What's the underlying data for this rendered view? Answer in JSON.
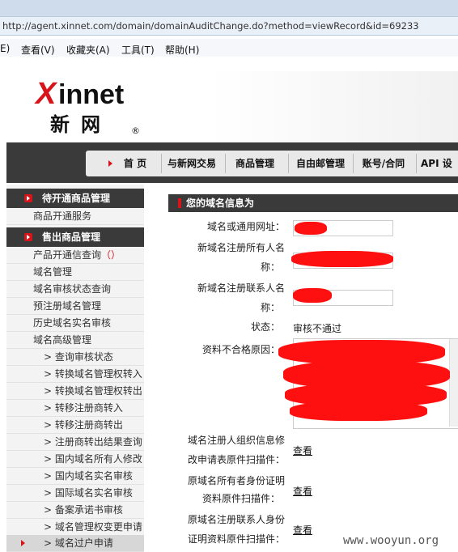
{
  "browser": {
    "url": "http://agent.xinnet.com/domain/domainAuditChange.do?method=viewRecord&id=69233",
    "menu": [
      "E)",
      "查看(V)",
      "收藏夹(A)",
      "工具(T)",
      "帮助(H)"
    ]
  },
  "logo": {
    "x": "X",
    "word": "innet",
    "cn": "新网",
    "reg": "®"
  },
  "nav": [
    "首 页",
    "与新网交易",
    "商品管理",
    "自由邮管理",
    "账号/合同",
    "API 设"
  ],
  "sidebar": {
    "section1": "待开通商品管理",
    "section1_items": [
      "商品开通服务"
    ],
    "section2": "售出商品管理",
    "section2_items": [
      "产品开通信查询",
      "域名管理",
      "域名审核状态查询",
      "预注册域名管理",
      "历史域名实名审核",
      "域名高级管理"
    ],
    "paren": "（）",
    "sub_items": [
      "> 查询审核状态",
      "> 转换域名管理权转入",
      "> 转换域名管理权转出",
      "> 转移注册商转入",
      "> 转移注册商转出",
      "> 注册商转出结果查询",
      "> 国内域名所有人修改",
      "> 国内域名实名审核",
      "> 国际域名实名审核",
      "> 备案承诺书审核",
      "> 域名管理权变更申请",
      "> 域名过户申请"
    ]
  },
  "main": {
    "title": "您的域名信息为",
    "fields": {
      "domain_label": "域名或通用网址：",
      "owner_label_1": "新域名注册所有人名",
      "owner_label_2": "称：",
      "contact_label_1": "新域名注册联系人名",
      "contact_label_2": "称：",
      "status_label": "状态：",
      "status_value": "审核不通过",
      "reason_label": "资料不合格原因：",
      "org_label_1": "域名注册人组织信息修",
      "org_label_2": "改申请表原件扫描件：",
      "id_label_1": "原域名所有者身份证明",
      "id_label_2": "资料原件扫描件：",
      "contact_id_label_1": "原域名注册联系人身份",
      "contact_id_label_2": "证明资料原件扫描件：",
      "view": "查看"
    }
  },
  "watermark": "www.wooyun.org",
  "colors": {
    "accent": "#d8141b",
    "dark": "#3a3a3a",
    "redaction": "#ff1010"
  }
}
